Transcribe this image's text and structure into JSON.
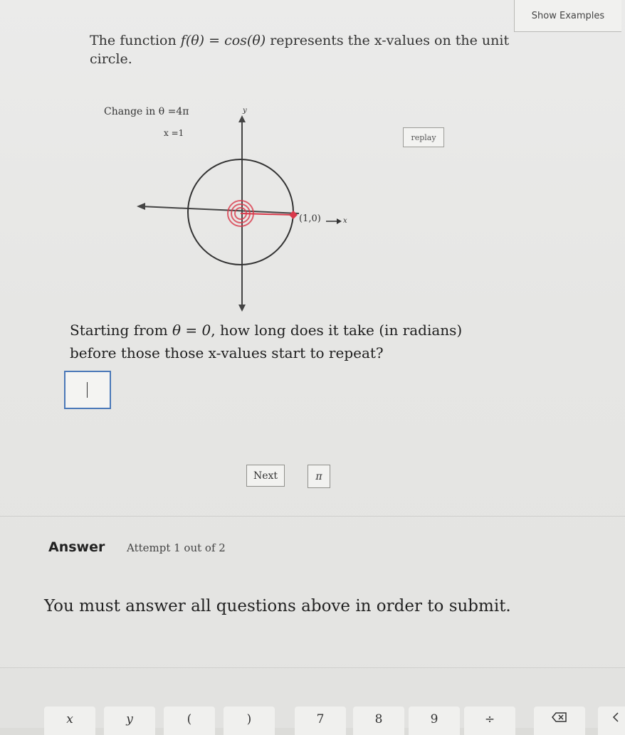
{
  "header": {
    "show_examples_label": "Show Examples"
  },
  "intro": {
    "prefix": "The function ",
    "function": "f(θ) = cos(θ)",
    "suffix": " represents the x-values on the unit circle."
  },
  "graph": {
    "change_label": "Change in θ =4π",
    "x_label": "x =1",
    "point_label": "(1,0)",
    "y_axis_label": "y",
    "x_axis_label": "x",
    "replay_label": "replay"
  },
  "question": {
    "prefix": "Starting from ",
    "math": "θ = 0",
    "suffix": ", how long does it take (in radians) before those those x-values start to repeat?"
  },
  "answer_input": {
    "value": ""
  },
  "buttons": {
    "next_label": "Next",
    "pi_label": "π"
  },
  "answer_section": {
    "label": "Answer",
    "attempt": "Attempt 1 out of 2",
    "message": "You must answer all questions above in order to submit."
  },
  "keyboard": {
    "keys": [
      "x",
      "y",
      "(",
      ")",
      "7",
      "8",
      "9",
      "÷"
    ]
  },
  "colors": {
    "accent": "#4a78b8",
    "highlight_red": "#d9394b"
  }
}
